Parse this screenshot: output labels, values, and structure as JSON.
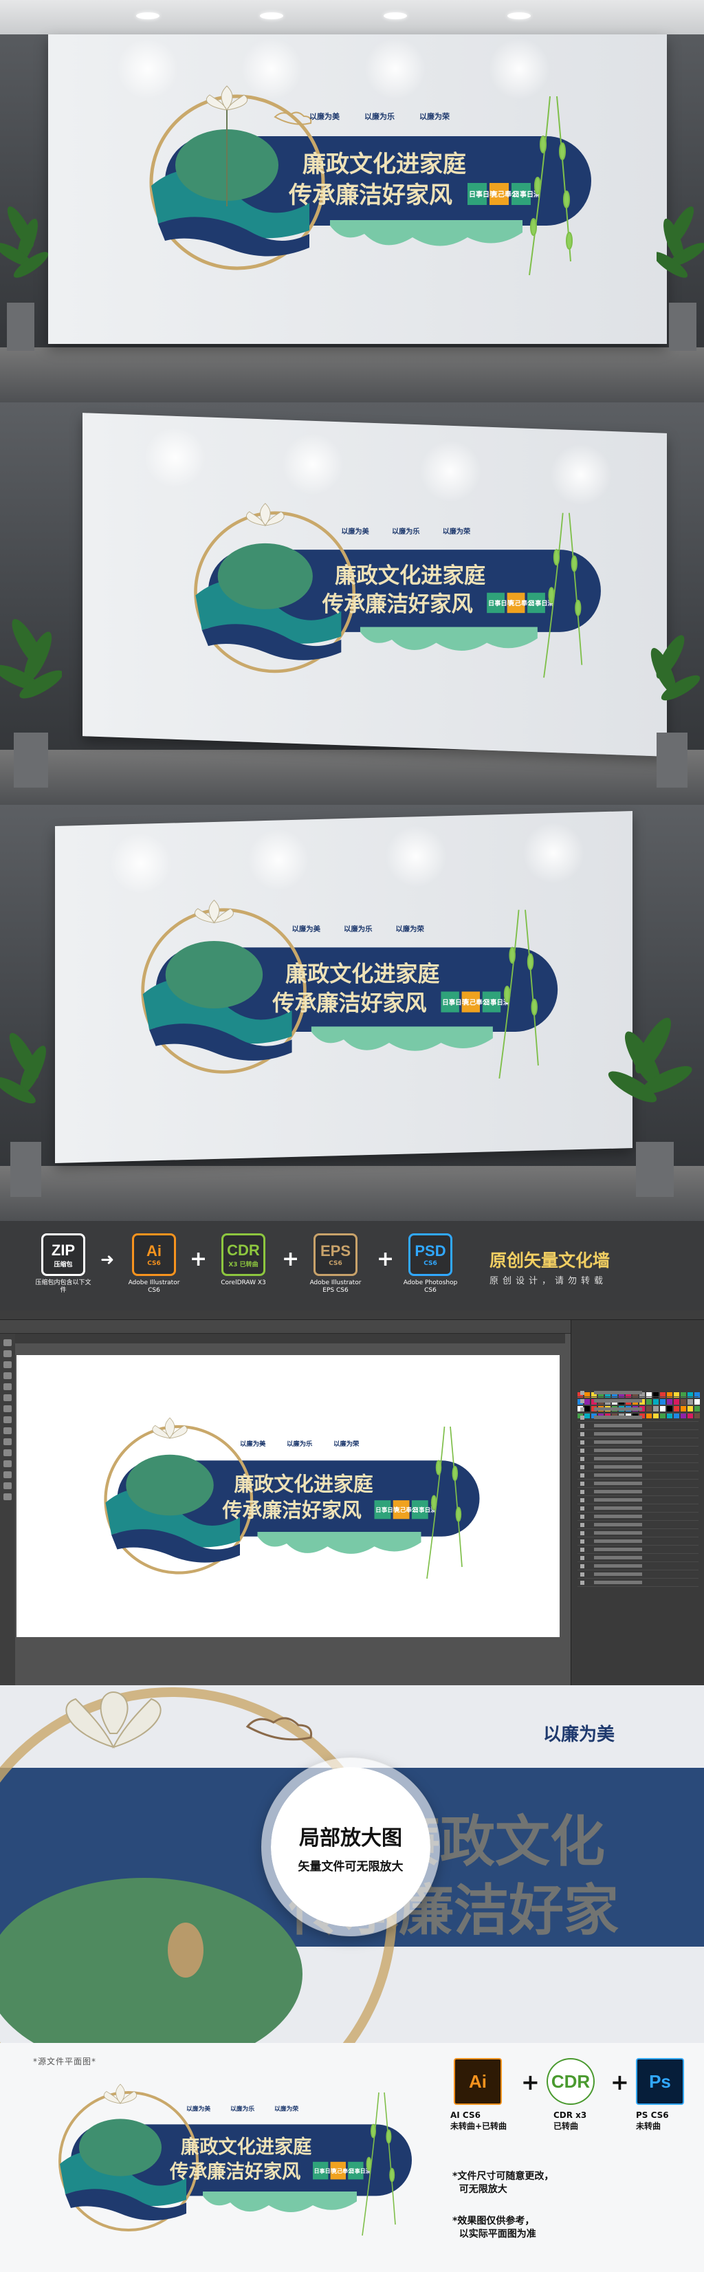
{
  "sign": {
    "line1": "廉政文化进家庭",
    "line2": "传承廉洁好家风",
    "top_items": [
      "以廉为美",
      "以廉为乐",
      "以廉为荣"
    ],
    "badges": [
      {
        "label": "日事日毕",
        "color": "#2fa37a"
      },
      {
        "label": "克己奉公",
        "color": "#f0a21f"
      },
      {
        "label": "日事日清",
        "color": "#2fa37a"
      }
    ],
    "colors": {
      "navy": "#1f3a6e",
      "gold": "#c9a86a",
      "green": "#3f8f6f",
      "mint": "#79c9a7",
      "teal": "#1e8a8a"
    }
  },
  "strip": {
    "zip_label": "ZIP",
    "zip_sub": "压缩包",
    "zip_caption": "压缩包内包含以下文件",
    "formats": [
      {
        "big": "Ai",
        "small": "CS6",
        "caption": "Adobe Illustrator CS6",
        "color": "#f7931e"
      },
      {
        "big": "CDR",
        "small": "X3 已转曲",
        "caption": "CorelDRAW X3",
        "color": "#8dc63f"
      },
      {
        "big": "EPS",
        "small": "CS6",
        "caption": "Adobe Illustrator EPS CS6",
        "color": "#c8a26a"
      },
      {
        "big": "PSD",
        "small": "CS6",
        "caption": "Adobe Photoshop CS6",
        "color": "#31a8ff"
      }
    ],
    "headline": "原创矢量文化墙",
    "subline": "原创设计，请勿转载"
  },
  "zoom": {
    "title": "局部放大图",
    "subtitle": "矢量文件可无限放大",
    "top_item": "以廉为美",
    "bg_text1": "廉政文化",
    "bg_text2": "传承廉洁好家"
  },
  "flat": {
    "label": "*源文件平面图*",
    "icons": [
      {
        "text": "Ai",
        "caption": "AI CS6\n未转曲+已转曲",
        "bg": "#2e1a05",
        "fg": "#f7931e"
      },
      {
        "text": "CDR",
        "caption": "CDR x3\n已转曲",
        "bg": "#ffffff",
        "fg": "#4a9a2f"
      },
      {
        "text": "Ps",
        "caption": "PS CS6\n未转曲",
        "bg": "#061e3a",
        "fg": "#31a8ff"
      }
    ],
    "notes": [
      "*文件尺寸可随意更改，\n  可无限放大",
      "*效果图仅供参考，\n  以实际平面图为准"
    ]
  }
}
